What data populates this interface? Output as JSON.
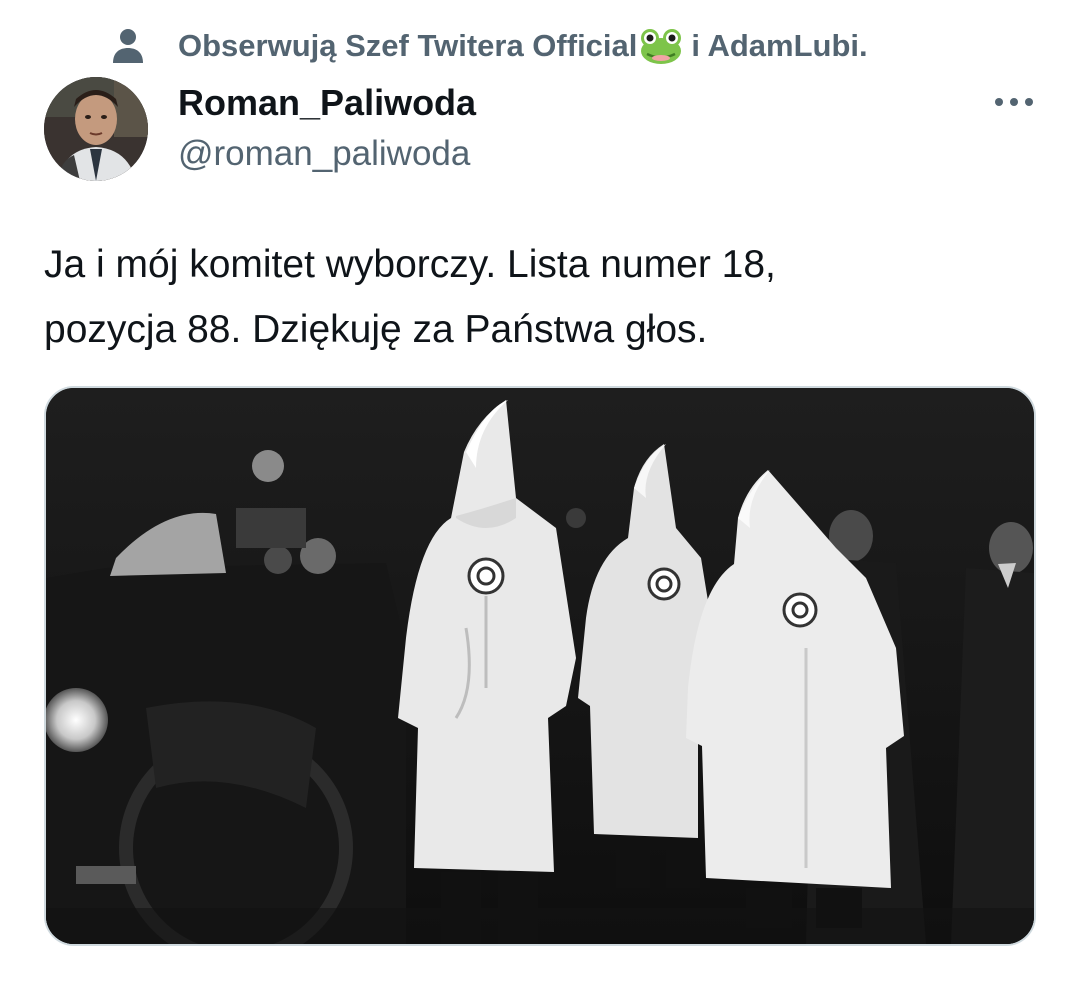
{
  "social_context": {
    "prefix": "Obserwują Szef Twitera Official",
    "suffix": "i AdamLubi.",
    "icon": "person-icon",
    "emoji": "frog-icon"
  },
  "author": {
    "display_name": "Roman_Paliwoda",
    "handle": "@roman_paliwoda"
  },
  "more_icon": "more-horizontal-icon",
  "tweet": {
    "line1": "Ja i mój komitet wyborczy. Lista numer 18,",
    "line2": "pozycja 88. Dziękuję za Państwa głos."
  },
  "colors": {
    "text": "#0f1419",
    "secondary": "#536471",
    "border": "#cfd9de"
  }
}
